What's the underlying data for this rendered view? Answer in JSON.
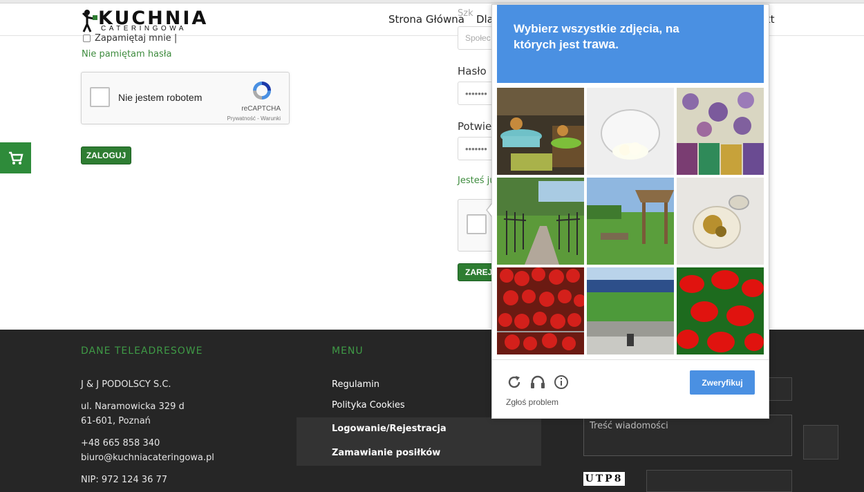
{
  "header": {
    "logo_word": "KUCHNIA",
    "logo_sub": "CATERINGOWA",
    "nav": [
      "Strona Główna",
      "Dla",
      "kt"
    ]
  },
  "login": {
    "remember_label": "Zapamiętaj mnie |",
    "forgot_label": "Nie pamiętam hasła",
    "recaptcha_label": "Nie jestem robotem",
    "recaptcha_brand": "reCAPTCHA",
    "recaptcha_privacy": "Prywatność - Warunki",
    "submit_label": "ZALOGUJ"
  },
  "register": {
    "partial_label_top": "Szk",
    "field1_placeholder": "Społec",
    "password_label": "Hasło",
    "password_value": "•••••••",
    "confirm_label": "Potwier",
    "confirm_value": "•••••••",
    "already_link": "Jesteś ju",
    "submit_label": "ZAREJE"
  },
  "challenge": {
    "instruction_line1": "Wybierz wszystkie zdjęcia, na",
    "instruction_line2_prefix": "których jest ",
    "keyword": "trawa",
    "instruction_line2_suffix": ".",
    "verify_label": "Zweryfikuj",
    "report_label": "Zgłoś problem",
    "tiles": [
      "cake-decorations",
      "white-flower-bowl",
      "fabric-tassels",
      "garden-gate",
      "wooden-structure-lawn",
      "glass-jar-flowers",
      "strawberries",
      "stadium-field",
      "red-peppers"
    ],
    "icons": [
      "reload-icon",
      "audio-icon",
      "info-icon"
    ]
  },
  "footer": {
    "contact_heading": "DANE TELEADRESOWE",
    "company": "J & J PODOLSCY S.C.",
    "street": "ul. Naramowicka 329 d",
    "city": "61-601, Poznań",
    "phone": "+48 665 858 340",
    "email": "biuro@kuchniacateringowa.pl",
    "nip": "NIP: 972 124 36 77",
    "menu_heading": "MENU",
    "menu_items": [
      "Regulamin",
      "Polityka Cookies",
      "Logowanie/Rejestracja",
      "Zamawianie posiłków"
    ],
    "message_placeholder": "Treść wiadomości",
    "captcha_text": "UTP8"
  },
  "colors": {
    "brand_green": "#2e7d32",
    "link_green": "#3d8b3d",
    "footer_bg": "#262626",
    "challenge_blue": "#4a90e2"
  }
}
